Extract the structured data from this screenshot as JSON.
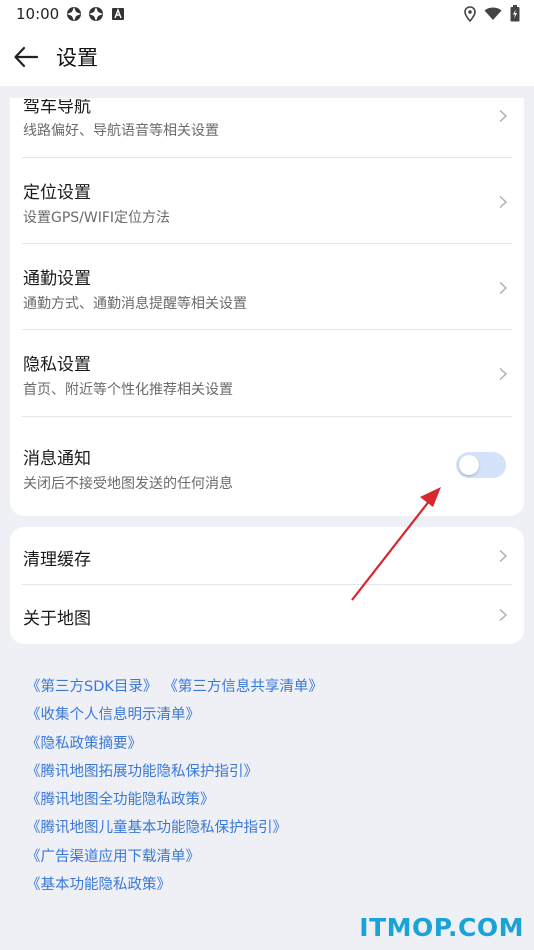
{
  "status_bar": {
    "time": "10:00"
  },
  "app_bar": {
    "title": "设置"
  },
  "settings_card": {
    "items": [
      {
        "title": "驾车导航",
        "subtitle": "线路偏好、导航语音等相关设置"
      },
      {
        "title": "定位设置",
        "subtitle": "设置GPS/WIFI定位方法"
      },
      {
        "title": "通勤设置",
        "subtitle": "通勤方式、通勤消息提醒等相关设置"
      },
      {
        "title": "隐私设置",
        "subtitle": "首页、附近等个性化推荐相关设置"
      }
    ],
    "notification": {
      "title": "消息通知",
      "subtitle": "关闭后不接受地图发送的任何消息",
      "enabled": false
    }
  },
  "misc_card": {
    "items": [
      {
        "title": "清理缓存"
      },
      {
        "title": "关于地图"
      }
    ]
  },
  "links": {
    "row1_a": "《第三方SDK目录》",
    "row1_b": "《第三方信息共享清单》",
    "items": [
      "《收集个人信息明示清单》",
      "《隐私政策摘要》",
      "《腾讯地图拓展功能隐私保护指引》",
      "《腾讯地图全功能隐私政策》",
      "《腾讯地图儿童基本功能隐私保护指引》",
      "《广告渠道应用下载清单》",
      "《基本功能隐私政策》"
    ]
  },
  "watermark": "ITMOP.COM",
  "colors": {
    "link": "#3a78d8",
    "background": "#eef0f5",
    "toggle_off": "#d3e3fa",
    "annotation_arrow": "#d9272e",
    "watermark": "#1aa3d6"
  },
  "icons": [
    "back-arrow-icon",
    "chevron-right-icon",
    "location-icon",
    "wifi-icon",
    "battery-icon",
    "notification-icon",
    "app-icon"
  ]
}
